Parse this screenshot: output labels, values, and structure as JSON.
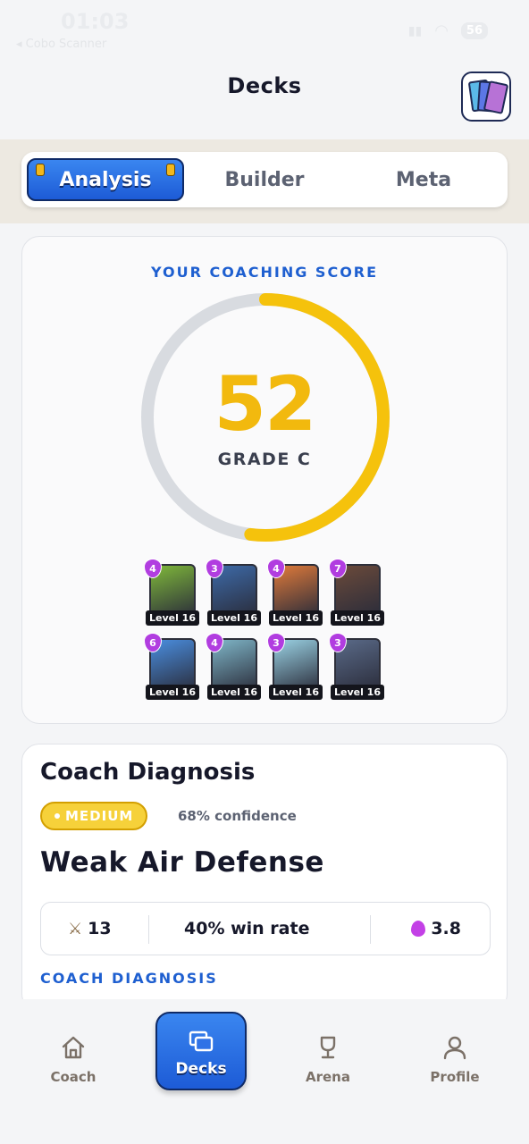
{
  "status_bar": {
    "time": "01:03",
    "back_label": "◂ Cobo Scanner",
    "battery": "56"
  },
  "header": {
    "title": "Decks",
    "cards_button_icon": "card-collection-icon"
  },
  "tabs": [
    {
      "label": "Analysis",
      "active": true
    },
    {
      "label": "Builder",
      "active": false
    },
    {
      "label": "Meta",
      "active": false
    }
  ],
  "score": {
    "eyebrow": "YOUR COACHING SCORE",
    "value": "52",
    "progress_fraction": 0.52,
    "grade": "GRADE C",
    "colors": {
      "ring_fill": "#f5c20c",
      "ring_track": "#d8dbe0",
      "accent": "#1e5fd0"
    }
  },
  "deck": [
    {
      "cost": "4",
      "level": "Level 16",
      "card": "goblin"
    },
    {
      "cost": "3",
      "level": "Level 16",
      "card": "mini-pekka"
    },
    {
      "cost": "4",
      "level": "Level 16",
      "card": "valkyrie"
    },
    {
      "cost": "7",
      "level": "Level 16",
      "card": "lava-hound"
    },
    {
      "cost": "6",
      "level": "Level 16",
      "card": "elixir-collector"
    },
    {
      "cost": "4",
      "level": "Level 16",
      "card": "bone-dragon"
    },
    {
      "cost": "3",
      "level": "Level 16",
      "card": "arrows"
    },
    {
      "cost": "3",
      "level": "Level 16",
      "card": "skeleton-knight"
    }
  ],
  "diagnosis": {
    "title": "Coach Diagnosis",
    "severity": "MEDIUM",
    "confidence": "68% confidence",
    "headline": "Weak Air Defense",
    "stats": {
      "battles": "13",
      "win_rate": "40% win rate",
      "avg_elixir": "3.8"
    },
    "section_label": "COACH DIAGNOSIS"
  },
  "nav": {
    "coach": "Coach",
    "decks": "Decks",
    "arena": "Arena",
    "profile": "Profile"
  }
}
